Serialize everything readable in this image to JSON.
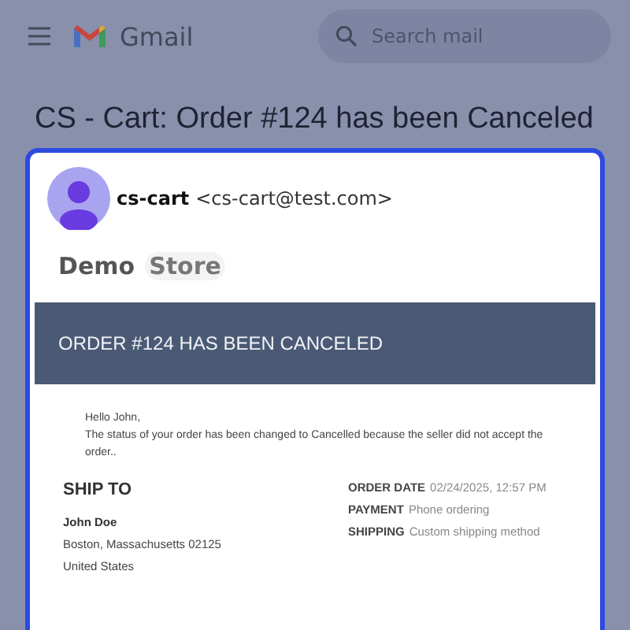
{
  "app_bar": {
    "brand": "Gmail",
    "search": {
      "placeholder": "Search mail"
    }
  },
  "subject": "CS - Cart: Order #124 has been Canceled",
  "message": {
    "sender_name": "cs-cart",
    "sender_email": "<cs-cart@test.com>",
    "store_logo": [
      "Demo",
      "Store"
    ],
    "banner": "ORDER #124 HAS BEEN CANCELED",
    "greeting": "Hello John,",
    "body": "The status of your order has been changed to Cancelled because the seller did not accept the order..",
    "ship_to": {
      "heading": "SHIP TO",
      "name": "John Doe",
      "lines": [
        "Boston, Massachusetts 02125",
        "United States"
      ]
    },
    "details": [
      {
        "label": "ORDER DATE",
        "value": "02/24/2025, 12:57 PM"
      },
      {
        "label": "PAYMENT",
        "value": "Phone ordering"
      },
      {
        "label": "SHIPPING",
        "value": "Custom shipping method"
      }
    ]
  }
}
